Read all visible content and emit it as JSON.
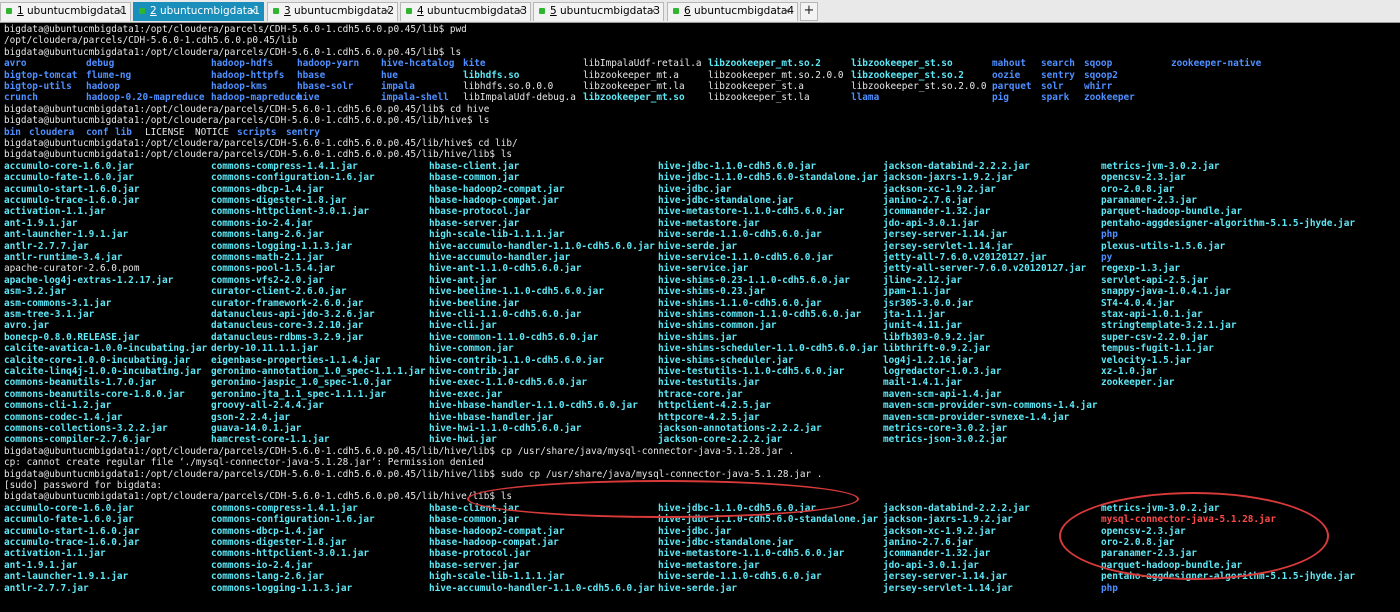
{
  "tabs": [
    {
      "num": "1",
      "title": "ubuntucmbigdata1",
      "active": false
    },
    {
      "num": "2",
      "title": "ubuntucmbigdata1",
      "active": true
    },
    {
      "num": "3",
      "title": "ubuntucmbigdata2",
      "active": false
    },
    {
      "num": "4",
      "title": "ubuntucmbigdata3",
      "active": false
    },
    {
      "num": "5",
      "title": "ubuntucmbigdata3",
      "active": false
    },
    {
      "num": "6",
      "title": "ubuntucmbigdata4",
      "active": false
    }
  ],
  "add_tab_label": "+",
  "close_glyph": "×",
  "lines": [
    {
      "type": "text",
      "text": "bigdata@ubuntucmbigdata1:/opt/cloudera/parcels/CDH-5.6.0-1.cdh5.6.0.p0.45/lib$ pwd"
    },
    {
      "type": "text",
      "text": "/opt/cloudera/parcels/CDH-5.6.0-1.cdh5.6.0.p0.45/lib"
    },
    {
      "type": "text",
      "text": "bigdata@ubuntucmbigdata1:/opt/cloudera/parcels/CDH-5.6.0-1.cdh5.6.0.p0.45/lib$ ls"
    },
    {
      "type": "cols",
      "cells": [
        {
          "t": "avro",
          "k": "d"
        },
        {
          "t": "debug",
          "k": "d"
        },
        {
          "t": "hadoop-hdfs",
          "k": "d"
        },
        {
          "t": "hadoop-yarn",
          "k": "d"
        },
        {
          "t": "hive-hcatalog",
          "k": "d"
        },
        {
          "t": "kite",
          "k": "d"
        },
        {
          "t": "libImpalaUdf-retail.a",
          "k": "w"
        },
        {
          "t": "libzookeeper_mt.so.2",
          "k": "f"
        },
        {
          "t": "libzookeeper_st.so",
          "k": "f"
        },
        {
          "t": "mahout",
          "k": "d"
        },
        {
          "t": "search",
          "k": "d"
        },
        {
          "t": "sqoop",
          "k": "d"
        },
        {
          "t": "zookeeper-native",
          "k": "d"
        }
      ]
    },
    {
      "type": "cols",
      "cells": [
        {
          "t": "bigtop-tomcat",
          "k": "d"
        },
        {
          "t": "flume-ng",
          "k": "d"
        },
        {
          "t": "hadoop-httpfs",
          "k": "d"
        },
        {
          "t": "hbase",
          "k": "d"
        },
        {
          "t": "hue",
          "k": "d"
        },
        {
          "t": "libhdfs.so",
          "k": "f"
        },
        {
          "t": "libzookeeper_mt.a",
          "k": "w"
        },
        {
          "t": "libzookeeper_mt.so.2.0.0",
          "k": "w"
        },
        {
          "t": "libzookeeper_st.so.2",
          "k": "f"
        },
        {
          "t": "oozie",
          "k": "d"
        },
        {
          "t": "sentry",
          "k": "d"
        },
        {
          "t": "sqoop2",
          "k": "d"
        }
      ]
    },
    {
      "type": "cols",
      "cells": [
        {
          "t": "bigtop-utils",
          "k": "d"
        },
        {
          "t": "hadoop",
          "k": "d"
        },
        {
          "t": "hadoop-kms",
          "k": "d"
        },
        {
          "t": "hbase-solr",
          "k": "d"
        },
        {
          "t": "impala",
          "k": "d"
        },
        {
          "t": "libhdfs.so.0.0.0",
          "k": "w"
        },
        {
          "t": "libzookeeper_mt.la",
          "k": "w"
        },
        {
          "t": "libzookeeper_st.a",
          "k": "w"
        },
        {
          "t": "libzookeeper_st.so.2.0.0",
          "k": "w"
        },
        {
          "t": "parquet",
          "k": "d"
        },
        {
          "t": "solr",
          "k": "d"
        },
        {
          "t": "whirr",
          "k": "d"
        }
      ]
    },
    {
      "type": "cols",
      "cells": [
        {
          "t": "crunch",
          "k": "d"
        },
        {
          "t": "hadoop-0.20-mapreduce",
          "k": "d"
        },
        {
          "t": "hadoop-mapreduce",
          "k": "d"
        },
        {
          "t": "hive",
          "k": "d"
        },
        {
          "t": "impala-shell",
          "k": "d"
        },
        {
          "t": "libImpalaUdf-debug.a",
          "k": "w"
        },
        {
          "t": "libzookeeper_mt.so",
          "k": "f"
        },
        {
          "t": "libzookeeper_st.la",
          "k": "w"
        },
        {
          "t": "llama",
          "k": "d"
        },
        {
          "t": "pig",
          "k": "d"
        },
        {
          "t": "spark",
          "k": "d"
        },
        {
          "t": "zookeeper",
          "k": "d"
        }
      ]
    },
    {
      "type": "text",
      "text": "bigdata@ubuntucmbigdata1:/opt/cloudera/parcels/CDH-5.6.0-1.cdh5.6.0.p0.45/lib$ cd hive"
    },
    {
      "type": "text",
      "text": "bigdata@ubuntucmbigdata1:/opt/cloudera/parcels/CDH-5.6.0-1.cdh5.6.0.p0.45/lib/hive$ ls"
    },
    {
      "type": "seq",
      "cells": [
        {
          "t": "bin",
          "k": "d"
        },
        {
          "t": "cloudera",
          "k": "d"
        },
        {
          "t": "conf",
          "k": "d"
        },
        {
          "t": "lib",
          "k": "d"
        },
        {
          "t": "LICENSE",
          "k": "w"
        },
        {
          "t": "NOTICE",
          "k": "w"
        },
        {
          "t": "scripts",
          "k": "d"
        },
        {
          "t": "sentry",
          "k": "d"
        }
      ]
    },
    {
      "type": "text",
      "text": "bigdata@ubuntucmbigdata1:/opt/cloudera/parcels/CDH-5.6.0-1.cdh5.6.0.p0.45/lib/hive$ cd lib/"
    },
    {
      "type": "text",
      "text": "bigdata@ubuntucmbigdata1:/opt/cloudera/parcels/CDH-5.6.0-1.cdh5.6.0.p0.45/lib/hive/lib$ ls"
    },
    {
      "type": "jar",
      "c": [
        "accumulo-core-1.6.0.jar",
        "commons-compress-1.4.1.jar",
        "hbase-client.jar",
        "hive-jdbc-1.1.0-cdh5.6.0.jar",
        "jackson-databind-2.2.2.jar",
        "metrics-jvm-3.0.2.jar"
      ]
    },
    {
      "type": "jar",
      "c": [
        "accumulo-fate-1.6.0.jar",
        "commons-configuration-1.6.jar",
        "hbase-common.jar",
        "hive-jdbc-1.1.0-cdh5.6.0-standalone.jar",
        "jackson-jaxrs-1.9.2.jar",
        "opencsv-2.3.jar"
      ]
    },
    {
      "type": "jar",
      "c": [
        "accumulo-start-1.6.0.jar",
        "commons-dbcp-1.4.jar",
        "hbase-hadoop2-compat.jar",
        "hive-jdbc.jar",
        "jackson-xc-1.9.2.jar",
        "oro-2.0.8.jar"
      ]
    },
    {
      "type": "jar",
      "c": [
        "accumulo-trace-1.6.0.jar",
        "commons-digester-1.8.jar",
        "hbase-hadoop-compat.jar",
        "hive-jdbc-standalone.jar",
        "janino-2.7.6.jar",
        "paranamer-2.3.jar"
      ]
    },
    {
      "type": "jar",
      "c": [
        "activation-1.1.jar",
        "commons-httpclient-3.0.1.jar",
        "hbase-protocol.jar",
        "hive-metastore-1.1.0-cdh5.6.0.jar",
        "jcommander-1.32.jar",
        "parquet-hadoop-bundle.jar"
      ]
    },
    {
      "type": "jar",
      "c": [
        "ant-1.9.1.jar",
        "commons-io-2.4.jar",
        "hbase-server.jar",
        "hive-metastore.jar",
        "jdo-api-3.0.1.jar",
        "pentaho-aggdesigner-algorithm-5.1.5-jhyde.jar"
      ]
    },
    {
      "type": "jar",
      "c": [
        "ant-launcher-1.9.1.jar",
        "commons-lang-2.6.jar",
        "high-scale-lib-1.1.1.jar",
        "hive-serde-1.1.0-cdh5.6.0.jar",
        "jersey-server-1.14.jar",
        "php"
      ],
      "dir5": true
    },
    {
      "type": "jar",
      "c": [
        "antlr-2.7.7.jar",
        "commons-logging-1.1.3.jar",
        "hive-accumulo-handler-1.1.0-cdh5.6.0.jar",
        "hive-serde.jar",
        "jersey-servlet-1.14.jar",
        "plexus-utils-1.5.6.jar"
      ]
    },
    {
      "type": "jar",
      "c": [
        "antlr-runtime-3.4.jar",
        "commons-math-2.1.jar",
        "hive-accumulo-handler.jar",
        "hive-service-1.1.0-cdh5.6.0.jar",
        "jetty-all-7.6.0.v20120127.jar",
        "py"
      ],
      "dir5": true
    },
    {
      "type": "jar",
      "c": [
        "apache-curator-2.6.0.pom",
        "commons-pool-1.5.4.jar",
        "hive-ant-1.1.0-cdh5.6.0.jar",
        "hive-service.jar",
        "jetty-all-server-7.6.0.v20120127.jar",
        "regexp-1.3.jar"
      ],
      "w0": true
    },
    {
      "type": "jar",
      "c": [
        "apache-log4j-extras-1.2.17.jar",
        "commons-vfs2-2.0.jar",
        "hive-ant.jar",
        "hive-shims-0.23-1.1.0-cdh5.6.0.jar",
        "jline-2.12.jar",
        "servlet-api-2.5.jar"
      ]
    },
    {
      "type": "jar",
      "c": [
        "asm-3.2.jar",
        "curator-client-2.6.0.jar",
        "hive-beeline-1.1.0-cdh5.6.0.jar",
        "hive-shims-0.23.jar",
        "jpam-1.1.jar",
        "snappy-java-1.0.4.1.jar"
      ]
    },
    {
      "type": "jar",
      "c": [
        "asm-commons-3.1.jar",
        "curator-framework-2.6.0.jar",
        "hive-beeline.jar",
        "hive-shims-1.1.0-cdh5.6.0.jar",
        "jsr305-3.0.0.jar",
        "ST4-4.0.4.jar"
      ]
    },
    {
      "type": "jar",
      "c": [
        "asm-tree-3.1.jar",
        "datanucleus-api-jdo-3.2.6.jar",
        "hive-cli-1.1.0-cdh5.6.0.jar",
        "hive-shims-common-1.1.0-cdh5.6.0.jar",
        "jta-1.1.jar",
        "stax-api-1.0.1.jar"
      ]
    },
    {
      "type": "jar",
      "c": [
        "avro.jar",
        "datanucleus-core-3.2.10.jar",
        "hive-cli.jar",
        "hive-shims-common.jar",
        "junit-4.11.jar",
        "stringtemplate-3.2.1.jar"
      ]
    },
    {
      "type": "jar",
      "c": [
        "bonecp-0.8.0.RELEASE.jar",
        "datanucleus-rdbms-3.2.9.jar",
        "hive-common-1.1.0-cdh5.6.0.jar",
        "hive-shims.jar",
        "libfb303-0.9.2.jar",
        "super-csv-2.2.0.jar"
      ]
    },
    {
      "type": "jar",
      "c": [
        "calcite-avatica-1.0.0-incubating.jar",
        "derby-10.11.1.1.jar",
        "hive-common.jar",
        "hive-shims-scheduler-1.1.0-cdh5.6.0.jar",
        "libthrift-0.9.2.jar",
        "tempus-fugit-1.1.jar"
      ]
    },
    {
      "type": "jar",
      "c": [
        "calcite-core-1.0.0-incubating.jar",
        "eigenbase-properties-1.1.4.jar",
        "hive-contrib-1.1.0-cdh5.6.0.jar",
        "hive-shims-scheduler.jar",
        "log4j-1.2.16.jar",
        "velocity-1.5.jar"
      ]
    },
    {
      "type": "jar",
      "c": [
        "calcite-linq4j-1.0.0-incubating.jar",
        "geronimo-annotation_1.0_spec-1.1.1.jar",
        "hive-contrib.jar",
        "hive-testutils-1.1.0-cdh5.6.0.jar",
        "logredactor-1.0.3.jar",
        "xz-1.0.jar"
      ]
    },
    {
      "type": "jar",
      "c": [
        "commons-beanutils-1.7.0.jar",
        "geronimo-jaspic_1.0_spec-1.0.jar",
        "hive-exec-1.1.0-cdh5.6.0.jar",
        "hive-testutils.jar",
        "mail-1.4.1.jar",
        "zookeeper.jar"
      ]
    },
    {
      "type": "jar",
      "c": [
        "commons-beanutils-core-1.8.0.jar",
        "geronimo-jta_1.1_spec-1.1.1.jar",
        "hive-exec.jar",
        "htrace-core.jar",
        "maven-scm-api-1.4.jar",
        ""
      ]
    },
    {
      "type": "jar",
      "c": [
        "commons-cli-1.2.jar",
        "groovy-all-2.4.4.jar",
        "hive-hbase-handler-1.1.0-cdh5.6.0.jar",
        "httpclient-4.2.5.jar",
        "maven-scm-provider-svn-commons-1.4.jar",
        ""
      ]
    },
    {
      "type": "jar",
      "c": [
        "commons-codec-1.4.jar",
        "gson-2.2.4.jar",
        "hive-hbase-handler.jar",
        "httpcore-4.2.5.jar",
        "maven-scm-provider-svnexe-1.4.jar",
        ""
      ]
    },
    {
      "type": "jar",
      "c": [
        "commons-collections-3.2.2.jar",
        "guava-14.0.1.jar",
        "hive-hwi-1.1.0-cdh5.6.0.jar",
        "jackson-annotations-2.2.2.jar",
        "metrics-core-3.0.2.jar",
        ""
      ]
    },
    {
      "type": "jar",
      "c": [
        "commons-compiler-2.7.6.jar",
        "hamcrest-core-1.1.jar",
        "hive-hwi.jar",
        "jackson-core-2.2.2.jar",
        "metrics-json-3.0.2.jar",
        ""
      ]
    },
    {
      "type": "text",
      "text": "bigdata@ubuntucmbigdata1:/opt/cloudera/parcels/CDH-5.6.0-1.cdh5.6.0.p0.45/lib/hive/lib$ cp /usr/share/java/mysql-connector-java-5.1.28.jar ."
    },
    {
      "type": "text",
      "text": "cp: cannot create regular file ‘./mysql-connector-java-5.1.28.jar’: Permission denied"
    },
    {
      "type": "text",
      "text": "bigdata@ubuntucmbigdata1:/opt/cloudera/parcels/CDH-5.6.0-1.cdh5.6.0.p0.45/lib/hive/lib$ sudo cp /usr/share/java/mysql-connector-java-5.1.28.jar ."
    },
    {
      "type": "text",
      "text": "[sudo] password for bigdata:"
    },
    {
      "type": "text",
      "text": "bigdata@ubuntucmbigdata1:/opt/cloudera/parcels/CDH-5.6.0-1.cdh5.6.0.p0.45/lib/hive/lib$ ls"
    },
    {
      "type": "jar",
      "c": [
        "accumulo-core-1.6.0.jar",
        "commons-compress-1.4.1.jar",
        "hbase-client.jar",
        "hive-jdbc-1.1.0-cdh5.6.0.jar",
        "jackson-databind-2.2.2.jar",
        "metrics-jvm-3.0.2.jar"
      ]
    },
    {
      "type": "jar",
      "c": [
        "accumulo-fate-1.6.0.jar",
        "commons-configuration-1.6.jar",
        "hbase-common.jar",
        "hive-jdbc-1.1.0-cdh5.6.0-standalone.jar",
        "jackson-jaxrs-1.9.2.jar",
        "mysql-connector-java-5.1.28.jar"
      ],
      "red5": true
    },
    {
      "type": "jar",
      "c": [
        "accumulo-start-1.6.0.jar",
        "commons-dbcp-1.4.jar",
        "hbase-hadoop2-compat.jar",
        "hive-jdbc.jar",
        "jackson-xc-1.9.2.jar",
        "opencsv-2.3.jar"
      ]
    },
    {
      "type": "jar",
      "c": [
        "accumulo-trace-1.6.0.jar",
        "commons-digester-1.8.jar",
        "hbase-hadoop-compat.jar",
        "hive-jdbc-standalone.jar",
        "janino-2.7.6.jar",
        "oro-2.0.8.jar"
      ]
    },
    {
      "type": "jar",
      "c": [
        "activation-1.1.jar",
        "commons-httpclient-3.0.1.jar",
        "hbase-protocol.jar",
        "hive-metastore-1.1.0-cdh5.6.0.jar",
        "jcommander-1.32.jar",
        "paranamer-2.3.jar"
      ]
    },
    {
      "type": "jar",
      "c": [
        "ant-1.9.1.jar",
        "commons-io-2.4.jar",
        "hbase-server.jar",
        "hive-metastore.jar",
        "jdo-api-3.0.1.jar",
        "parquet-hadoop-bundle.jar"
      ]
    },
    {
      "type": "jar",
      "c": [
        "ant-launcher-1.9.1.jar",
        "commons-lang-2.6.jar",
        "high-scale-lib-1.1.1.jar",
        "hive-serde-1.1.0-cdh5.6.0.jar",
        "jersey-server-1.14.jar",
        "pentaho-aggdesigner-algorithm-5.1.5-jhyde.jar"
      ]
    },
    {
      "type": "jar",
      "c": [
        "antlr-2.7.7.jar",
        "commons-logging-1.1.3.jar",
        "hive-accumulo-handler-1.1.0-cdh5.6.0.jar",
        "hive-serde.jar",
        "jersey-servlet-1.14.jar",
        "php"
      ],
      "dir5": true
    }
  ]
}
